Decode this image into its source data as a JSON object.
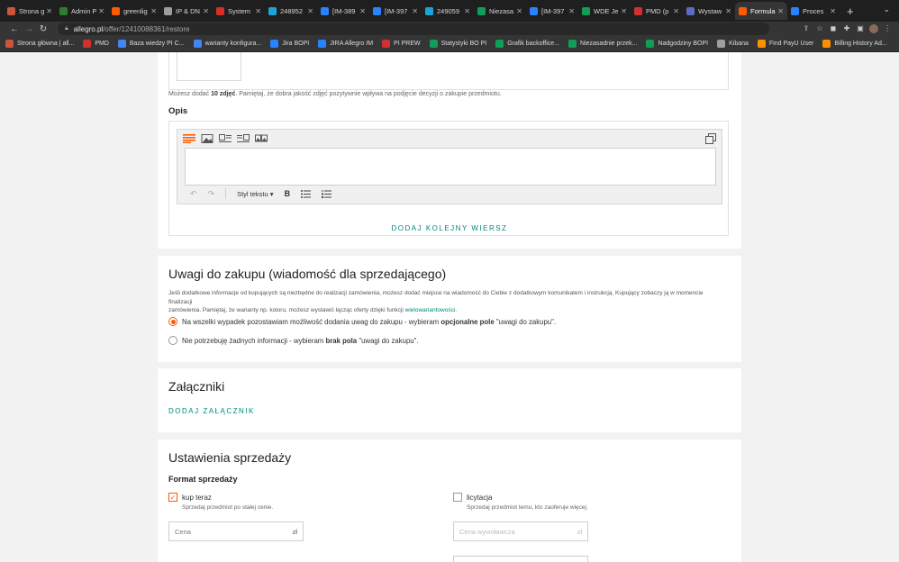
{
  "browser": {
    "tabs": [
      {
        "label": "Strona g",
        "color": "#c8553d"
      },
      {
        "label": "Admin P",
        "color": "#2e7d32"
      },
      {
        "label": "greenlig",
        "color": "#ff5a00"
      },
      {
        "label": "IP & DN",
        "color": "#9e9e9e"
      },
      {
        "label": "System",
        "color": "#d93025"
      },
      {
        "label": "248952",
        "color": "#1fa3d6"
      },
      {
        "label": "[IM-389",
        "color": "#2684ff"
      },
      {
        "label": "[IM-397",
        "color": "#2684ff"
      },
      {
        "label": "249059",
        "color": "#1fa3d6"
      },
      {
        "label": "Niezasa",
        "color": "#0f9d58"
      },
      {
        "label": "[IM-397",
        "color": "#2684ff"
      },
      {
        "label": "WDE Je",
        "color": "#0f9d58"
      },
      {
        "label": "PMD (p",
        "color": "#d32f2f"
      },
      {
        "label": "Wystaw",
        "color": "#5c6bc0"
      },
      {
        "label": "Formula",
        "color": "#ff5a00"
      },
      {
        "label": "Proces",
        "color": "#2684ff"
      }
    ],
    "active_tab_index": 14,
    "new_tab": "+",
    "url_host": "allegro.pl",
    "url_path": "/offer/12410088361/restore",
    "bookmarks": [
      {
        "label": "Strona główna | all...",
        "color": "#c8553d"
      },
      {
        "label": "PMD",
        "color": "#d32f2f"
      },
      {
        "label": "Baza wiedzy PI C...",
        "color": "#4285f4"
      },
      {
        "label": "warianty konfigura...",
        "color": "#4285f4"
      },
      {
        "label": "Jira BOPI",
        "color": "#2684ff"
      },
      {
        "label": "JIRA Allegro IM",
        "color": "#2684ff"
      },
      {
        "label": "PI PREW",
        "color": "#d32f2f"
      },
      {
        "label": "Statystyki BO PI",
        "color": "#0f9d58"
      },
      {
        "label": "Grafik backoffice...",
        "color": "#0f9d58"
      },
      {
        "label": "Niezasadnie przek...",
        "color": "#0f9d58"
      },
      {
        "label": "Nadgodziny BOPI",
        "color": "#0f9d58"
      },
      {
        "label": "Kibana",
        "color": "#9e9e9e"
      },
      {
        "label": "Find PayU User",
        "color": "#ff8f00"
      },
      {
        "label": "Billing History Ad...",
        "color": "#ff8f00"
      }
    ]
  },
  "photos": {
    "hint_prefix": "Możesz dodać",
    "hint_count": "10 zdjęć",
    "hint_suffix": ". Pamiętaj, że dobra jakość zdjęć pozytywnie wpływa na podjęcie decyzji o zakupie przedmiotu."
  },
  "description": {
    "heading": "Opis",
    "style_label": "Styl tekstu",
    "bold_label": "B",
    "add_row": "DODAJ KOLEJNY WIERSZ"
  },
  "buyer_notes": {
    "heading": "Uwagi do zakupu (wiadomość dla sprzedającego)",
    "desc_line1": "Jeśli dodatkowe informacje od kupujących są niezbędne do realizacji zamówienia, możesz dodać miejsce na wiadomość do Ciebie z dodatkowym komunikatem i instrukcją. Kupujący zobaczy ją w momencie finalizacji",
    "desc_line2_prefix": "zamówienia. Pamiętaj, że warianty np. koloru, możesz wystawić łącząc oferty dzięki funkcji",
    "desc_link": "wielowariantowości",
    "desc_end": ".",
    "option1_prefix": "Na wszelki wypadek pozostawiam możliwość dodania uwag do zakupu - wybieram",
    "option1_bold": "opcjonalne pole",
    "option1_suffix": "\"uwagi do zakupu\".",
    "option2_prefix": "Nie potrzebuję żadnych informacji - wybieram",
    "option2_bold": "brak pola",
    "option2_suffix": "\"uwagi do zakupu\".",
    "selected": 1
  },
  "attachments": {
    "heading": "Załączniki",
    "add": "DODAJ ZAŁĄCZNIK"
  },
  "sale_settings": {
    "heading": "Ustawienia sprzedaży",
    "format_heading": "Format sprzedaży",
    "buy_now_label": "kup teraz",
    "buy_now_desc": "Sprzedaj przedmiot po stałej cenie.",
    "buy_now_checked": true,
    "auction_label": "licytacja",
    "auction_desc": "Sprzedaj przedmiot temu, kto zaoferuje więcej.",
    "auction_checked": false,
    "price_placeholder": "Cena",
    "start_price_placeholder": "Cena wywoławcza",
    "currency": "zł"
  }
}
